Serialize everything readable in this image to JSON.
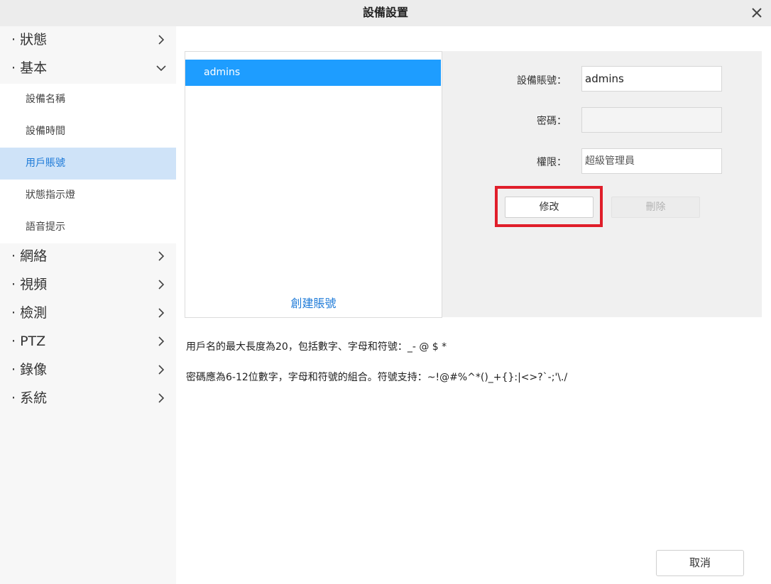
{
  "window": {
    "title": "設備設置",
    "close_icon": "close-icon"
  },
  "sidebar": {
    "top": [
      {
        "label": "· 狀態",
        "chevron": "chevron-right-icon"
      },
      {
        "label": "· 基本",
        "chevron": "chevron-down-icon"
      },
      {
        "label": "· 網絡",
        "chevron": "chevron-right-icon"
      },
      {
        "label": "· 視頻",
        "chevron": "chevron-right-icon"
      },
      {
        "label": "· 檢測",
        "chevron": "chevron-right-icon"
      },
      {
        "label": "· PTZ",
        "chevron": "chevron-right-icon"
      },
      {
        "label": "· 錄像",
        "chevron": "chevron-right-icon"
      },
      {
        "label": "· 系統",
        "chevron": "chevron-right-icon"
      }
    ],
    "sub": [
      {
        "label": "設備名稱"
      },
      {
        "label": "設備時間"
      },
      {
        "label": "用戶賬號",
        "active": true
      },
      {
        "label": "狀態指示燈"
      },
      {
        "label": "語音提示"
      }
    ]
  },
  "accounts": {
    "items": [
      "admins"
    ],
    "create_label": "創建賬號"
  },
  "form": {
    "account_label": "設備賬號：",
    "account_value": "admins",
    "password_label": "密碼：",
    "password_value": "",
    "permission_label": "權限：",
    "permission_value": "超級管理員",
    "modify_label": "修改",
    "delete_label": "刪除"
  },
  "notes": {
    "username_rule": "用戶名的最大長度為20，包括數字、字母和符號：_- @ $ *",
    "password_rule": "密碼應為6-12位數字，字母和符號的組合。符號支持：~!@#%^*()_+{}:|<>?`-;'\\./"
  },
  "footer": {
    "cancel_label": "取消"
  },
  "colors": {
    "accent": "#1e9dff",
    "link": "#1d7ad8",
    "active_bg": "#cfe3f8",
    "highlight": "#e01e2a"
  }
}
